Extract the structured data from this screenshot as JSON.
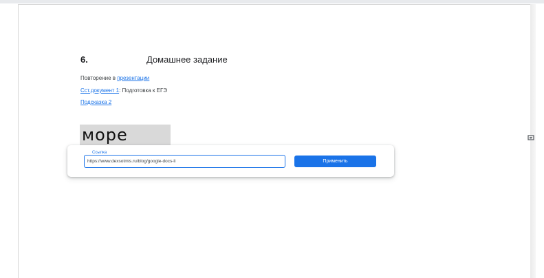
{
  "document": {
    "section_number": "6.",
    "section_title": "Домашнее задание",
    "paragraph1": {
      "text": "Повторение в ",
      "link": "презентации"
    },
    "paragraph2": {
      "link": "Сст.документ 1",
      "text": ": Подготовка к ЕГЭ"
    },
    "paragraph3": {
      "link": "Подсказка 2"
    },
    "highlighted_word": "море"
  },
  "link_popup": {
    "field_label": "Ссылка",
    "field_value": "https://www.dexsotmis.ru/blog/google-docs-li",
    "apply_label": "Применить"
  },
  "icons": {
    "side_icon": "comment-icon"
  },
  "colors": {
    "accent": "#1a73e8",
    "highlight": "#d9d9d9",
    "page_background": "#ffffff"
  }
}
